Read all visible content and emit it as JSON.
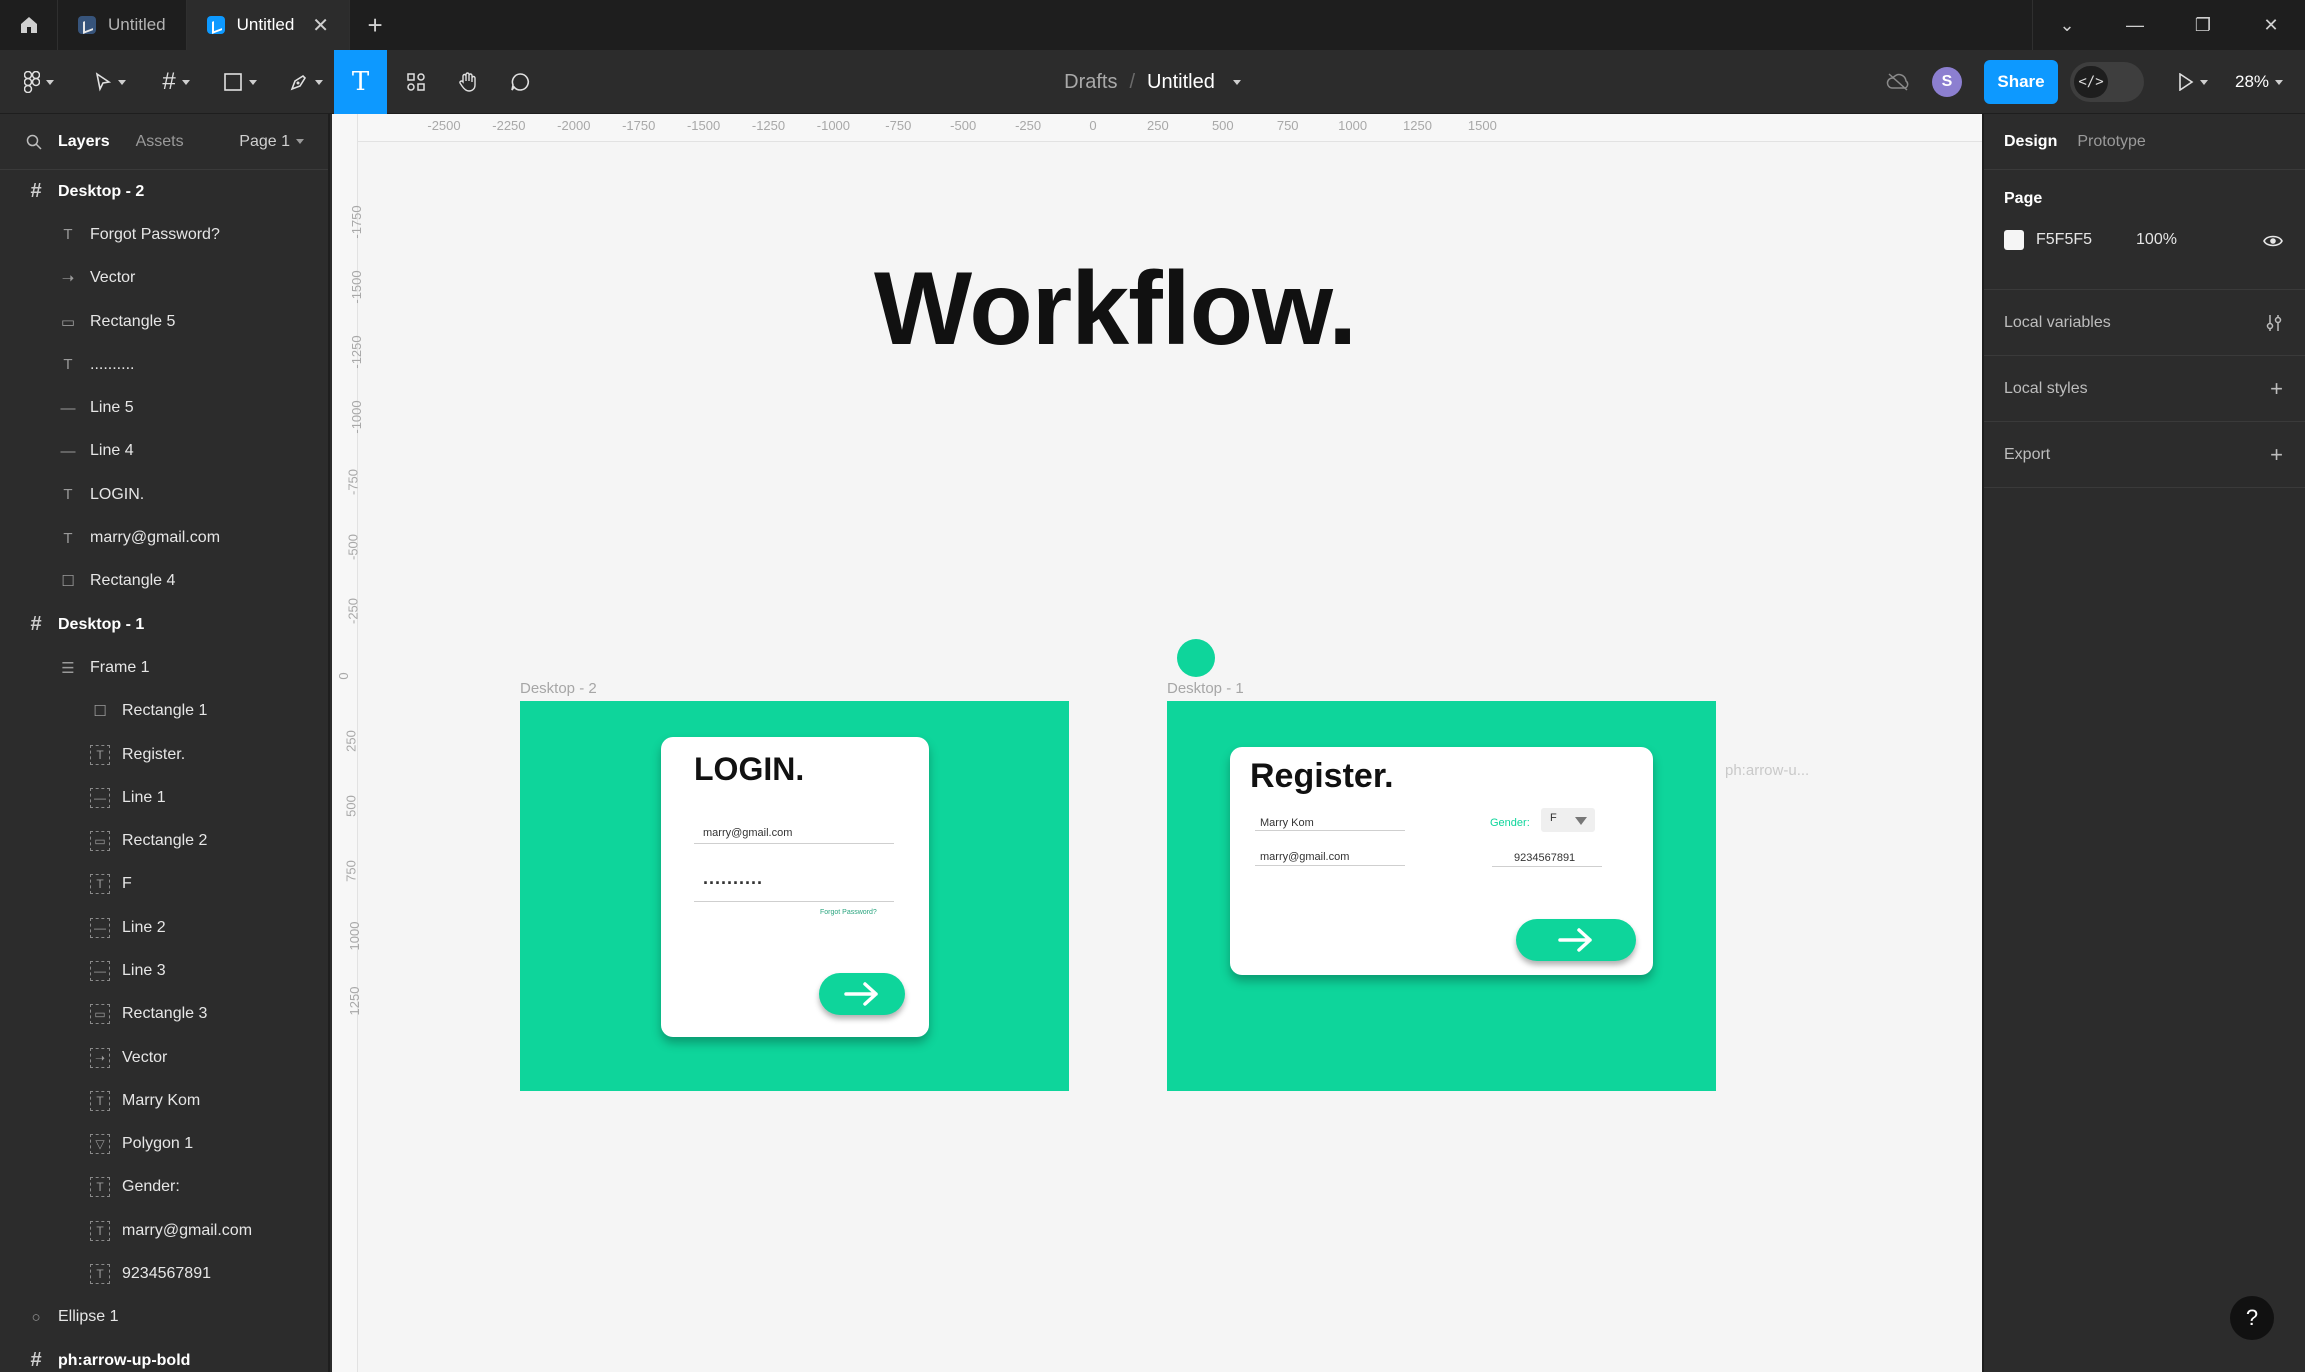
{
  "tabbar": {
    "tabs": [
      {
        "label": "Untitled",
        "active": false
      },
      {
        "label": "Untitled",
        "active": true
      }
    ]
  },
  "toolbar": {
    "breadcrumb_root": "Drafts",
    "breadcrumb_sep": "/",
    "file_name": "Untitled",
    "avatar_initial": "S",
    "share_label": "Share",
    "zoom": "28%"
  },
  "left_panel": {
    "tab_layers": "Layers",
    "tab_assets": "Assets",
    "page_label": "Page 1",
    "layers": [
      {
        "label": "Desktop - 2",
        "level": 0,
        "icon": "frame-icon",
        "bold": true
      },
      {
        "label": "Forgot Password?",
        "level": 1,
        "icon": "text-icon"
      },
      {
        "label": "Vector",
        "level": 1,
        "icon": "vector-arrow-icon"
      },
      {
        "label": "Rectangle 5",
        "level": 1,
        "icon": "rounded-rect-icon"
      },
      {
        "label": "..........",
        "level": 1,
        "icon": "text-icon"
      },
      {
        "label": "Line 5",
        "level": 1,
        "icon": "line-icon"
      },
      {
        "label": "Line 4",
        "level": 1,
        "icon": "line-icon"
      },
      {
        "label": "LOGIN.",
        "level": 1,
        "icon": "text-icon"
      },
      {
        "label": "marry@gmail.com",
        "level": 1,
        "icon": "text-icon"
      },
      {
        "label": "Rectangle 4",
        "level": 1,
        "icon": "rectangle-icon"
      },
      {
        "label": "Desktop - 1",
        "level": 0,
        "icon": "frame-icon",
        "bold": true
      },
      {
        "label": "Frame 1",
        "level": 1,
        "icon": "auto-layout-icon"
      },
      {
        "label": "Rectangle 1",
        "level": 2,
        "icon": "rectangle-icon"
      },
      {
        "label": "Register.",
        "level": 2,
        "icon": "text-abs-icon"
      },
      {
        "label": "Line 1",
        "level": 2,
        "icon": "line-abs-icon"
      },
      {
        "label": "Rectangle 2",
        "level": 2,
        "icon": "rect-abs-icon"
      },
      {
        "label": "F",
        "level": 2,
        "icon": "text-abs-icon"
      },
      {
        "label": "Line 2",
        "level": 2,
        "icon": "line-abs-icon"
      },
      {
        "label": "Line 3",
        "level": 2,
        "icon": "line-abs-icon"
      },
      {
        "label": "Rectangle 3",
        "level": 2,
        "icon": "rect-abs-icon"
      },
      {
        "label": "Vector",
        "level": 2,
        "icon": "vector-abs-icon"
      },
      {
        "label": "Marry Kom",
        "level": 2,
        "icon": "text-abs-icon"
      },
      {
        "label": "Polygon 1",
        "level": 2,
        "icon": "polygon-abs-icon"
      },
      {
        "label": "Gender:",
        "level": 2,
        "icon": "text-abs-icon"
      },
      {
        "label": "marry@gmail.com",
        "level": 2,
        "icon": "text-abs-icon"
      },
      {
        "label": "9234567891",
        "level": 2,
        "icon": "text-abs-icon"
      },
      {
        "label": "Ellipse 1",
        "level": 0,
        "icon": "ellipse-icon"
      },
      {
        "label": "ph:arrow-up-bold",
        "level": 0,
        "icon": "frame-icon",
        "bold": true
      }
    ]
  },
  "canvas": {
    "background": "#F5F5F5",
    "accent": "#0ED59B",
    "ruler_x": [
      "-2500",
      "-2250",
      "-2000",
      "-1750",
      "-1500",
      "-1250",
      "-1000",
      "-750",
      "-500",
      "-250",
      "0",
      "250",
      "500",
      "750",
      "1000",
      "1250",
      "1500"
    ],
    "ruler_y": [
      "-1750",
      "-1500",
      "-1250",
      "-1000",
      "-750",
      "-500",
      "-250",
      "0",
      "250",
      "500",
      "750",
      "1000",
      "1250"
    ],
    "heading": "Workflow.",
    "frame2_label": "Desktop - 2",
    "frame1_label": "Desktop - 1",
    "ph_label": "ph:arrow-u...",
    "login": {
      "title": "LOGIN.",
      "email": "marry@gmail.com",
      "password": "..........",
      "forgot": "Forgot Password?"
    },
    "register": {
      "title": "Register.",
      "name": "Marry Kom",
      "gender_label": "Gender:",
      "gender_value": "F",
      "email": "marry@gmail.com",
      "phone": "9234567891"
    }
  },
  "right_panel": {
    "tab_design": "Design",
    "tab_prototype": "Prototype",
    "page_title": "Page",
    "page_color": "F5F5F5",
    "page_opacity": "100%",
    "local_variables": "Local variables",
    "local_styles": "Local styles",
    "export": "Export"
  }
}
